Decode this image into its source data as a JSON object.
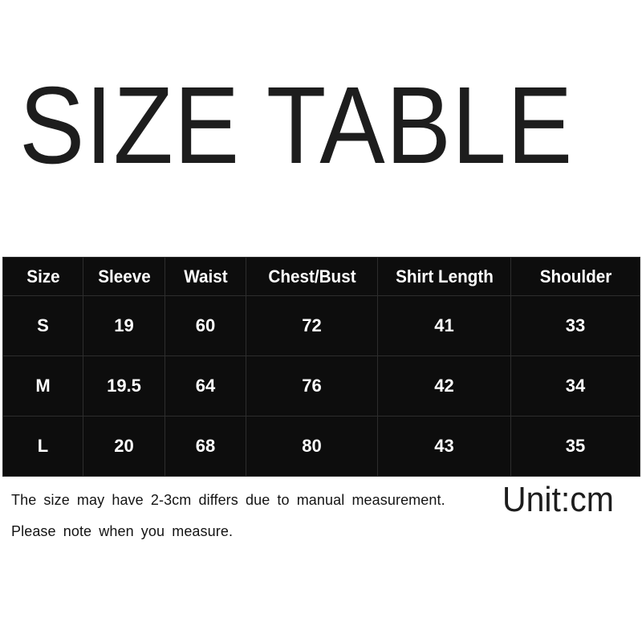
{
  "page": {
    "title": "SIZE TABLE",
    "background_color": "#ffffff",
    "text_color": "#1d1d1d"
  },
  "table": {
    "background_color": "#0d0d0d",
    "text_color": "#ffffff",
    "divider_color": "#2d2d2d",
    "columns": [
      "Size",
      "Sleeve",
      "Waist",
      "Chest/Bust",
      "Shirt Length",
      "Shoulder"
    ],
    "rows": [
      {
        "size": "S",
        "sleeve": "19",
        "waist": "60",
        "chest_bust": "72",
        "shirt_length": "41",
        "shoulder": "33"
      },
      {
        "size": "M",
        "sleeve": "19.5",
        "waist": "64",
        "chest_bust": "76",
        "shirt_length": "42",
        "shoulder": "34"
      },
      {
        "size": "L",
        "sleeve": "20",
        "waist": "68",
        "chest_bust": "80",
        "shirt_length": "43",
        "shoulder": "35"
      }
    ]
  },
  "footer": {
    "note_line_1": "The size may have 2-3cm differs due to manual measurement.",
    "note_line_2": "Please note when you measure.",
    "unit_label": "Unit:cm"
  }
}
